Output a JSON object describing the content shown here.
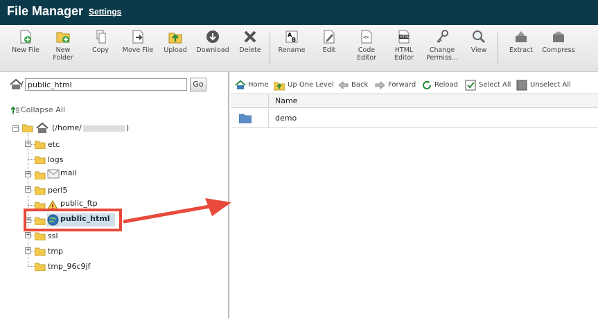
{
  "header": {
    "title": "File Manager",
    "settings_label": "Settings"
  },
  "toolbar": {
    "items": [
      {
        "label": "New File",
        "icon": "new-file-icon"
      },
      {
        "label": "New Folder",
        "icon": "new-folder-icon"
      },
      {
        "label": "Copy",
        "icon": "copy-icon"
      },
      {
        "label": "Move File",
        "icon": "move-file-icon"
      },
      {
        "label": "Upload",
        "icon": "upload-icon"
      },
      {
        "label": "Download",
        "icon": "download-icon"
      },
      {
        "label": "Delete",
        "icon": "delete-icon"
      },
      {
        "label": "Rename",
        "icon": "rename-icon"
      },
      {
        "label": "Edit",
        "icon": "edit-icon"
      },
      {
        "label": "Code Editor",
        "icon": "code-editor-icon"
      },
      {
        "label": "HTML Editor",
        "icon": "html-editor-icon"
      },
      {
        "label": "Change Permiss...",
        "icon": "permissions-icon"
      },
      {
        "label": "View",
        "icon": "view-icon"
      },
      {
        "label": "Extract",
        "icon": "extract-icon"
      },
      {
        "label": "Compress",
        "icon": "compress-icon"
      }
    ]
  },
  "path_bar": {
    "value": "public_html",
    "prefix": "/",
    "go_label": "Go"
  },
  "tree": {
    "collapse_all_label": "Collapse All",
    "root_label": "(/home/",
    "root_suffix": ")",
    "items": [
      {
        "label": "etc"
      },
      {
        "label": "logs"
      },
      {
        "label": "mail"
      },
      {
        "label": "perl5"
      },
      {
        "label": "public_ftp"
      },
      {
        "label": "public_html"
      },
      {
        "label": "ssl"
      },
      {
        "label": "tmp"
      },
      {
        "label": "tmp_96c9jf"
      }
    ]
  },
  "nav": {
    "home": "Home",
    "up_one_level": "Up One Level",
    "back": "Back",
    "forward": "Forward",
    "reload": "Reload",
    "select_all": "Select All",
    "unselect_all": "Unselect All"
  },
  "grid": {
    "columns": [
      "Name"
    ],
    "rows": [
      {
        "name": "demo",
        "type": "folder"
      }
    ]
  },
  "colors": {
    "header_bg": "#0b3a4a",
    "highlight": "#e8493a",
    "folder": "#f2c94c"
  }
}
